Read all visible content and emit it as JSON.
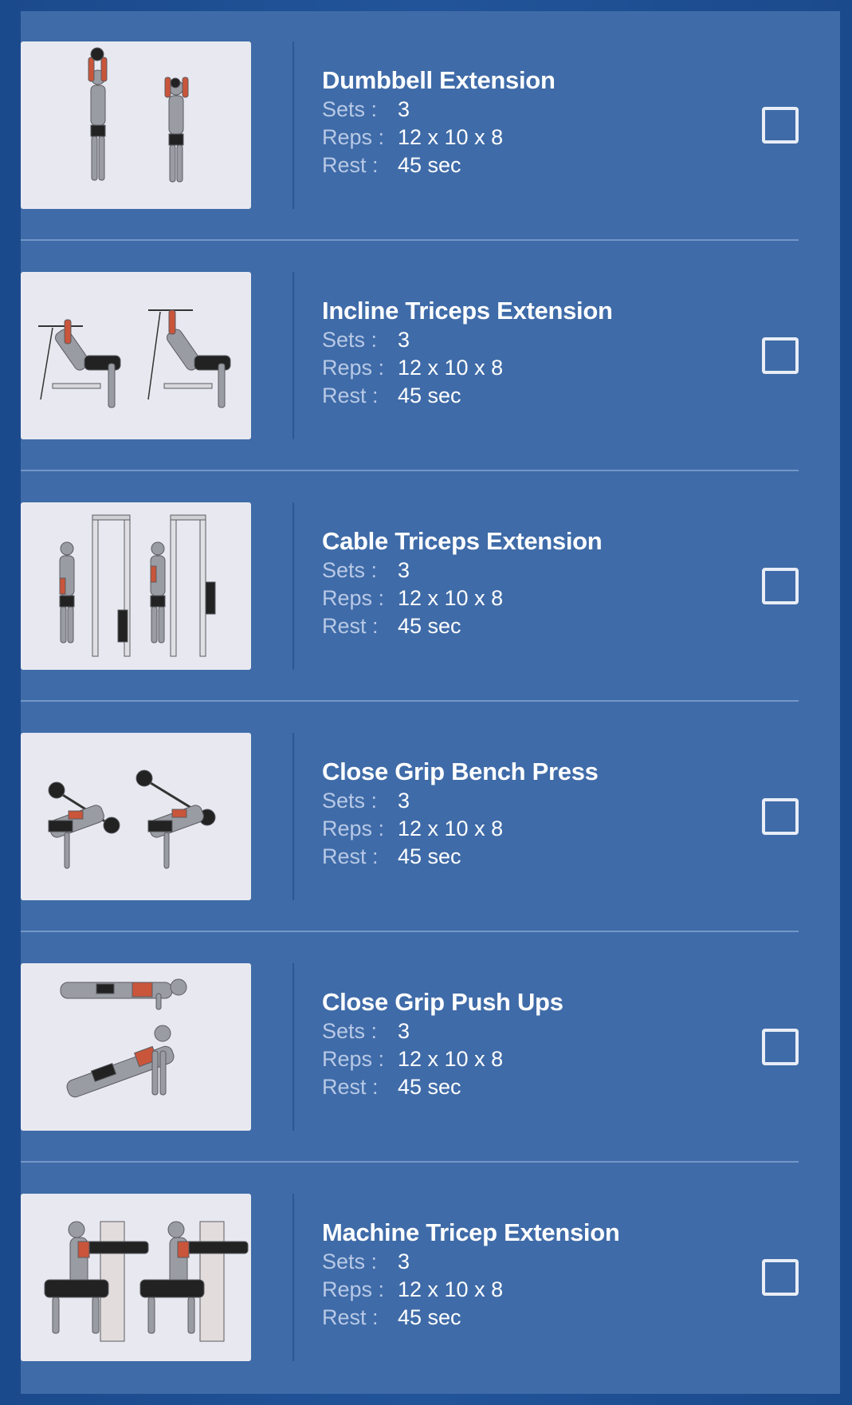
{
  "labels": {
    "sets": "Sets :",
    "reps": "Reps :",
    "rest": "Rest :"
  },
  "exercises": [
    {
      "name": "Dumbbell Extension",
      "sets": "3",
      "reps": "12 x 10 x 8",
      "rest": "45 sec",
      "checked": false
    },
    {
      "name": "Incline Triceps Extension",
      "sets": "3",
      "reps": "12 x 10 x 8",
      "rest": "45 sec",
      "checked": false
    },
    {
      "name": "Cable Triceps Extension",
      "sets": "3",
      "reps": "12 x 10 x 8",
      "rest": "45 sec",
      "checked": false
    },
    {
      "name": "Close Grip Bench Press",
      "sets": "3",
      "reps": "12 x 10 x 8",
      "rest": "45 sec",
      "checked": false
    },
    {
      "name": "Close Grip Push Ups",
      "sets": "3",
      "reps": "12 x 10 x 8",
      "rest": "45 sec",
      "checked": false
    },
    {
      "name": "Machine Tricep Extension",
      "sets": "3",
      "reps": "12 x 10 x 8",
      "rest": "45 sec",
      "checked": false
    }
  ],
  "colors": {
    "background": "#1f4f94",
    "panel": "#3f6ba8",
    "divider": "#7497c8",
    "label": "#b8c9e6",
    "value": "#ffffff",
    "thumbnail_bg": "#e8e9f0",
    "muscle_highlight": "#c9553a"
  }
}
